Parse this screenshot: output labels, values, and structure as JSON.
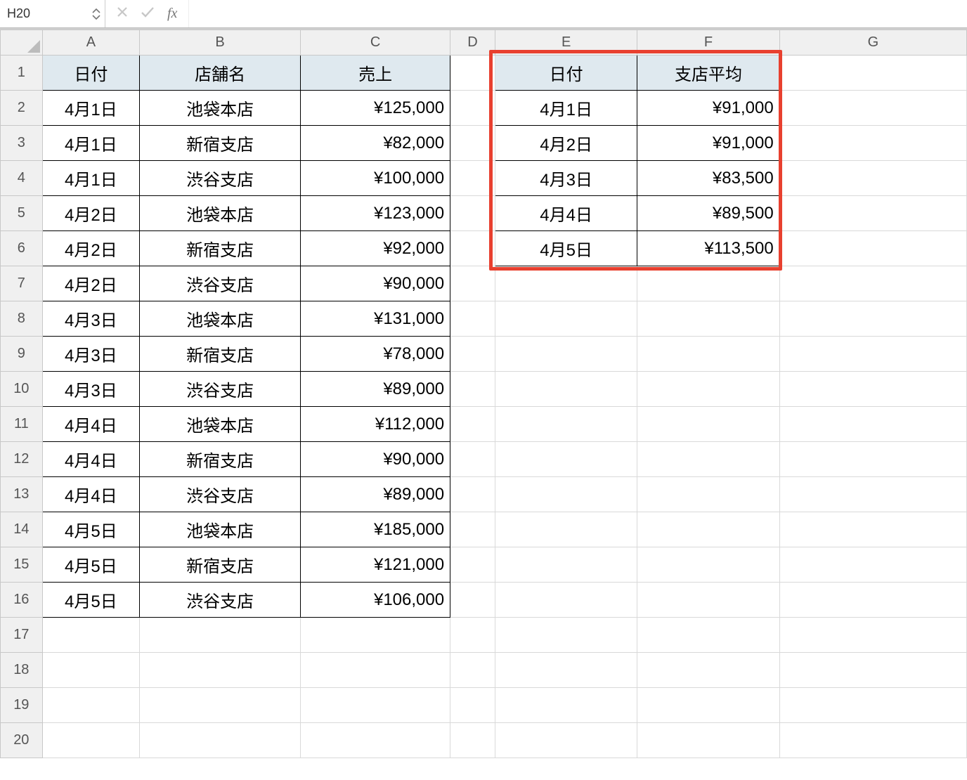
{
  "nameBox": "H20",
  "fxLabel": "fx",
  "columns": [
    "A",
    "B",
    "C",
    "D",
    "E",
    "F",
    "G"
  ],
  "rowCount": 20,
  "tableA": {
    "headers": {
      "A": "日付",
      "B": "店舗名",
      "C": "売上"
    },
    "rows": [
      {
        "A": "4月1日",
        "B": "池袋本店",
        "C": "¥125,000"
      },
      {
        "A": "4月1日",
        "B": "新宿支店",
        "C": "¥82,000"
      },
      {
        "A": "4月1日",
        "B": "渋谷支店",
        "C": "¥100,000"
      },
      {
        "A": "4月2日",
        "B": "池袋本店",
        "C": "¥123,000"
      },
      {
        "A": "4月2日",
        "B": "新宿支店",
        "C": "¥92,000"
      },
      {
        "A": "4月2日",
        "B": "渋谷支店",
        "C": "¥90,000"
      },
      {
        "A": "4月3日",
        "B": "池袋本店",
        "C": "¥131,000"
      },
      {
        "A": "4月3日",
        "B": "新宿支店",
        "C": "¥78,000"
      },
      {
        "A": "4月3日",
        "B": "渋谷支店",
        "C": "¥89,000"
      },
      {
        "A": "4月4日",
        "B": "池袋本店",
        "C": "¥112,000"
      },
      {
        "A": "4月4日",
        "B": "新宿支店",
        "C": "¥90,000"
      },
      {
        "A": "4月4日",
        "B": "渋谷支店",
        "C": "¥89,000"
      },
      {
        "A": "4月5日",
        "B": "池袋本店",
        "C": "¥185,000"
      },
      {
        "A": "4月5日",
        "B": "新宿支店",
        "C": "¥121,000"
      },
      {
        "A": "4月5日",
        "B": "渋谷支店",
        "C": "¥106,000"
      }
    ]
  },
  "tableE": {
    "headers": {
      "E": "日付",
      "F": "支店平均"
    },
    "rows": [
      {
        "E": "4月1日",
        "F": "¥91,000"
      },
      {
        "E": "4月2日",
        "F": "¥91,000"
      },
      {
        "E": "4月3日",
        "F": "¥83,500"
      },
      {
        "E": "4月4日",
        "F": "¥89,500"
      },
      {
        "E": "4月5日",
        "F": "¥113,500"
      }
    ]
  }
}
